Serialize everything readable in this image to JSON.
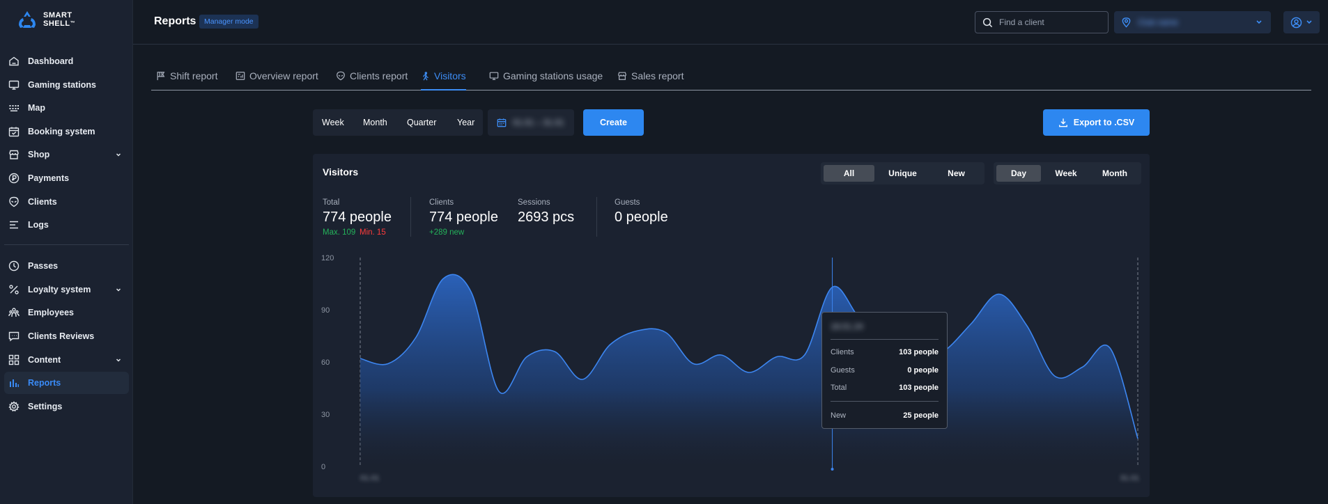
{
  "app": {
    "brand_line1": "SMART",
    "brand_line2": "SHELL",
    "brand_tm": "™",
    "accent": "#2d87f0"
  },
  "sidebar": {
    "items": [
      {
        "label": "Dashboard",
        "icon": "home-icon"
      },
      {
        "label": "Gaming stations",
        "icon": "monitor-icon"
      },
      {
        "label": "Map",
        "icon": "grid-dots-icon"
      },
      {
        "label": "Booking system",
        "icon": "calendar-check-icon"
      },
      {
        "label": "Shop",
        "icon": "store-icon",
        "expandable": true
      },
      {
        "label": "Payments",
        "icon": "coin-icon"
      },
      {
        "label": "Clients",
        "icon": "alien-head-icon"
      },
      {
        "label": "Logs",
        "icon": "lines-icon"
      },
      {
        "label": "Passes",
        "icon": "clock-icon"
      },
      {
        "label": "Loyalty system",
        "icon": "percent-icon",
        "expandable": true
      },
      {
        "label": "Employees",
        "icon": "people-icon"
      },
      {
        "label": "Clients Reviews",
        "icon": "chat-icon"
      },
      {
        "label": "Content",
        "icon": "squares-icon",
        "expandable": true
      },
      {
        "label": "Reports",
        "icon": "bar-chart-icon",
        "active": true
      },
      {
        "label": "Settings",
        "icon": "gear-icon"
      }
    ]
  },
  "header": {
    "title": "Reports",
    "mode_badge": "Manager mode",
    "search_placeholder": "Find a client",
    "club_name": "Club name"
  },
  "tabs": [
    {
      "label": "Shift report",
      "icon": "flag-icon"
    },
    {
      "label": "Overview report",
      "icon": "report-icon"
    },
    {
      "label": "Clients report",
      "icon": "alien-head-icon"
    },
    {
      "label": "Visitors",
      "icon": "walking-person-icon",
      "active": true
    },
    {
      "label": "Gaming stations usage",
      "icon": "monitor-icon"
    },
    {
      "label": "Sales report",
      "icon": "store-icon"
    }
  ],
  "toolbar": {
    "periods": [
      "Week",
      "Month",
      "Quarter",
      "Year"
    ],
    "date_range": "01.01 – 31.01",
    "create_label": "Create",
    "export_label": "Export to .CSV"
  },
  "visitors": {
    "title": "Visitors",
    "filter_type": {
      "options": [
        "All",
        "Unique",
        "New"
      ],
      "selected": "All"
    },
    "group_by": {
      "options": [
        "Day",
        "Week",
        "Month"
      ],
      "selected": "Day"
    },
    "stats": {
      "total_label": "Total",
      "total_value": "774 people",
      "max_text": "Max. 109",
      "min_text": "Min. 15",
      "clients_label": "Clients",
      "clients_value": "774 people",
      "clients_new": "+289 new",
      "sessions_label": "Sessions",
      "sessions_value": "2693 pcs",
      "guests_label": "Guests",
      "guests_value": "0 people"
    }
  },
  "chart_data": {
    "type": "area",
    "title": "",
    "xlabel": "",
    "ylabel": "",
    "ylim": [
      0,
      120
    ],
    "yticks": [
      0,
      30,
      60,
      90,
      120
    ],
    "x_start_label": "01.01",
    "x_end_label": "31.01",
    "grid": false,
    "color": "#2d6fd0",
    "series": [
      {
        "values": [
          62,
          59,
          74,
          108,
          100,
          43,
          63,
          66,
          50,
          70,
          78,
          77,
          59,
          64,
          54,
          63,
          64,
          103,
          85,
          76,
          61,
          66,
          82,
          99,
          81,
          52,
          57,
          68,
          16
        ]
      }
    ],
    "highlight_index": 17,
    "tooltip": {
      "date": "18.01.24",
      "rows": [
        {
          "label": "Clients",
          "value": "103 people"
        },
        {
          "label": "Guests",
          "value": "0 people"
        },
        {
          "label": "Total",
          "value": "103 people"
        },
        {
          "label": "New",
          "value": "25 people"
        }
      ]
    }
  }
}
